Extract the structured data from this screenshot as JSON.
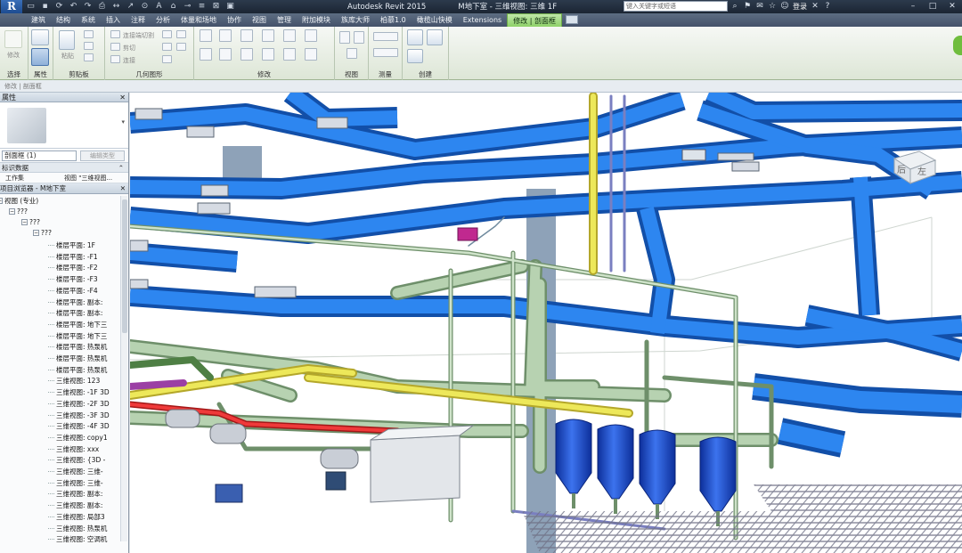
{
  "app": {
    "logo": "R",
    "title": "Autodesk Revit 2015",
    "document": "M地下室 - 三维视图: 三维 1F"
  },
  "search": {
    "placeholder": "键入关键字或短语"
  },
  "title_tools": {
    "login": "登录"
  },
  "icons": [
    "open-icon",
    "save-icon",
    "sync-icon",
    "undo-icon",
    "redo-icon",
    "print-icon",
    "measure-icon",
    "dimension-icon",
    "tag-icon",
    "text-icon",
    "view3d-icon",
    "section-icon",
    "thinlines-icon",
    "close-views-icon",
    "switch-windows-icon"
  ],
  "tabs": [
    "建筑",
    "结构",
    "系统",
    "插入",
    "注释",
    "分析",
    "体量和场地",
    "协作",
    "视图",
    "管理",
    "附加模块",
    "族库大师",
    "柏慕1.0",
    "橄榄山快模",
    "Extensions",
    "修改 | 剖面框"
  ],
  "ribbon": {
    "groups": [
      "选择",
      "属性",
      "剪贴板",
      "几何图形",
      "修改",
      "视图",
      "测量",
      "创建"
    ],
    "labels": {
      "modify": "修改",
      "paste": "粘贴",
      "cut_join": "连接端切割",
      "join": "连接",
      "cut": "剪切"
    }
  },
  "optionsbar": {
    "text": "修改 | 剖面框"
  },
  "properties": {
    "title": "属性",
    "type_name": "剖面框 (1)",
    "edit_type": "编辑类型",
    "category": "标识数据",
    "field_name": "工作集",
    "field_value": "视图 \"三维视图...",
    "dropdown": "▾",
    "collapse": "⌃"
  },
  "browser": {
    "title": "项目浏览器 - M地下室",
    "root": "视图 (专业)",
    "level1": "???",
    "level2": "???",
    "level3": "???",
    "items": [
      "楼层平面: 1F",
      "楼层平面: -F1",
      "楼层平面: -F2",
      "楼层平面: -F3",
      "楼层平面: -F4",
      "楼层平面: 副本:",
      "楼层平面: 副本:",
      "楼层平面: 地下三",
      "楼层平面: 地下三",
      "楼层平面: 热泵机",
      "楼层平面: 热泵机",
      "楼层平面: 热泵机",
      "三维视图: 123",
      "三维视图: -1F 3D",
      "三维视图: -2F 3D",
      "三维视图: -3F 3D",
      "三维视图: -4F 3D",
      "三维视图: copy1",
      "三维视图: xxx",
      "三维视图: {3D -",
      "三维视图: 三维-",
      "三维视图: 三维-",
      "三维视图: 副本:",
      "三维视图: 副本:",
      "三维视图: 局部3",
      "三维视图: 热泵机",
      "三维视图: 空调机"
    ]
  },
  "viewcube": {
    "face": "后",
    "face2": "左"
  },
  "colors": {
    "duct": "#1f6fd8",
    "duct_dark": "#124fa8",
    "pipe": "#a9c6a4",
    "pipe_dark": "#6e8f6a",
    "yellow": "#e8e23a",
    "red": "#e02828",
    "vessel": "#1b4fd2",
    "grid": "#7d7f92"
  }
}
